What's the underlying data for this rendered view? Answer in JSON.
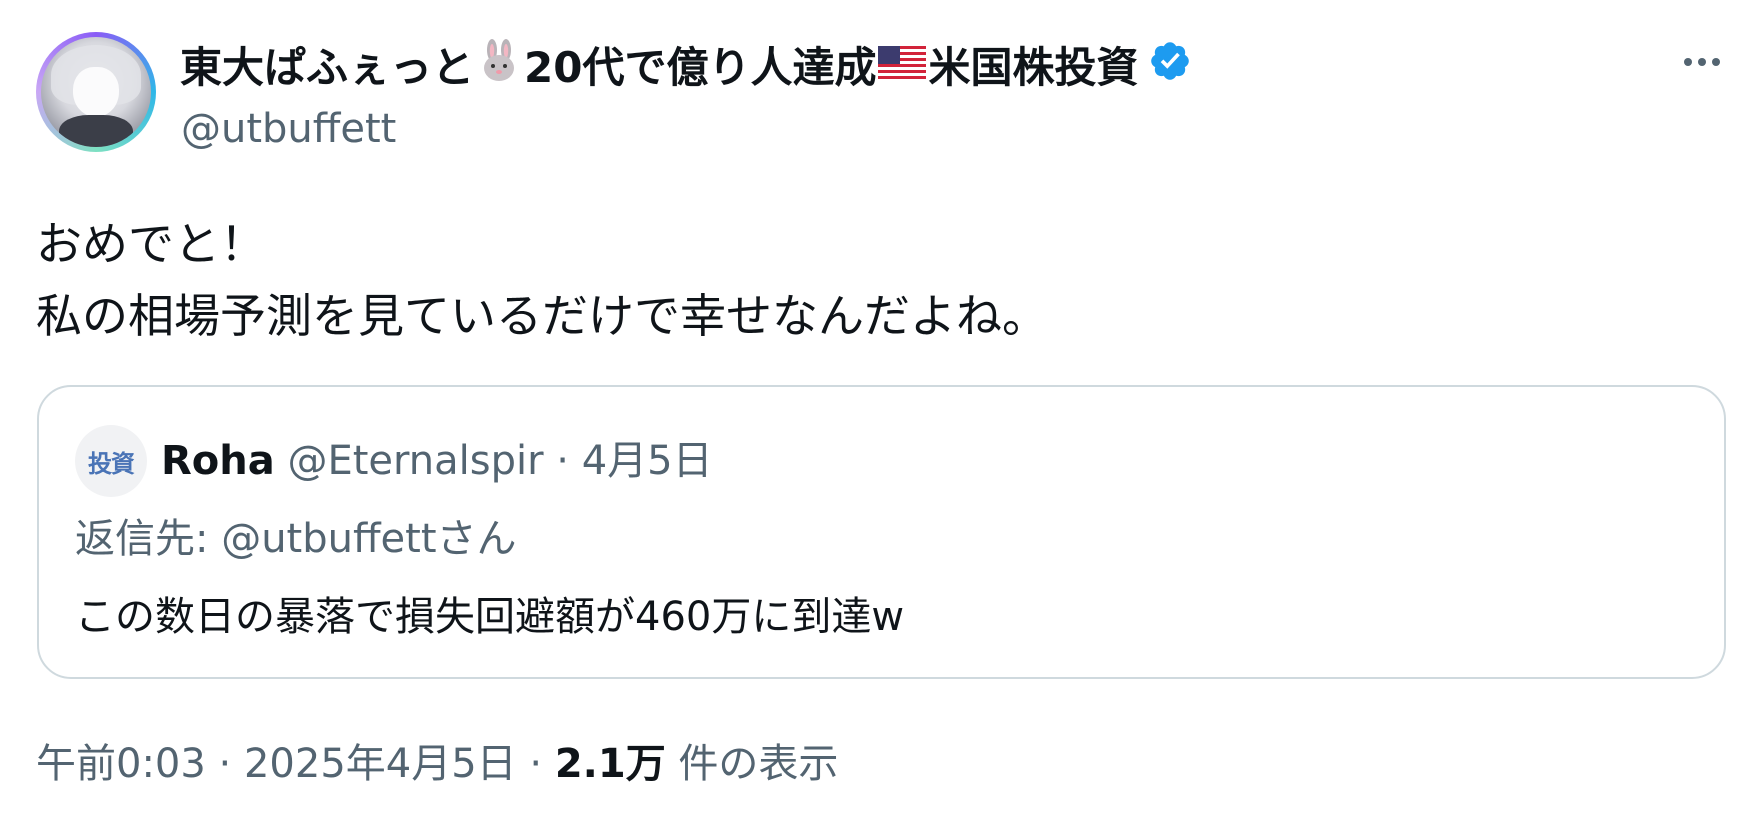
{
  "author": {
    "name_part1": "東大ぱふぇっと",
    "name_part2": "20代で億り人達成",
    "name_part3": "米国株投資",
    "handle": "@utbuffett"
  },
  "tweet": {
    "line1": "おめでと！",
    "line2": "私の相場予測を見ているだけで幸せなんだよね。"
  },
  "quote": {
    "avatar_text": "投資",
    "name": "Roha",
    "handle": "@Eternalspir",
    "separator": " · ",
    "date": "4月5日",
    "reply_prefix": "返信先: ",
    "reply_to": "@utbuffett",
    "reply_suffix": "さん",
    "text": "この数日の暴落で損失回避額が460万に到達w"
  },
  "footer": {
    "time": "午前0:03",
    "sep1": " · ",
    "date": "2025年4月5日",
    "sep2": " · ",
    "views_count": "2.1万",
    "views_label": " 件の表示"
  },
  "colors": {
    "text": "#0f1419",
    "secondary": "#536471",
    "verified": "#1d9bf0",
    "border": "#cfd9de"
  },
  "icons": [
    "avatar",
    "rabbit-emoji-icon",
    "us-flag-icon",
    "verified-badge-icon",
    "more-options-icon"
  ]
}
